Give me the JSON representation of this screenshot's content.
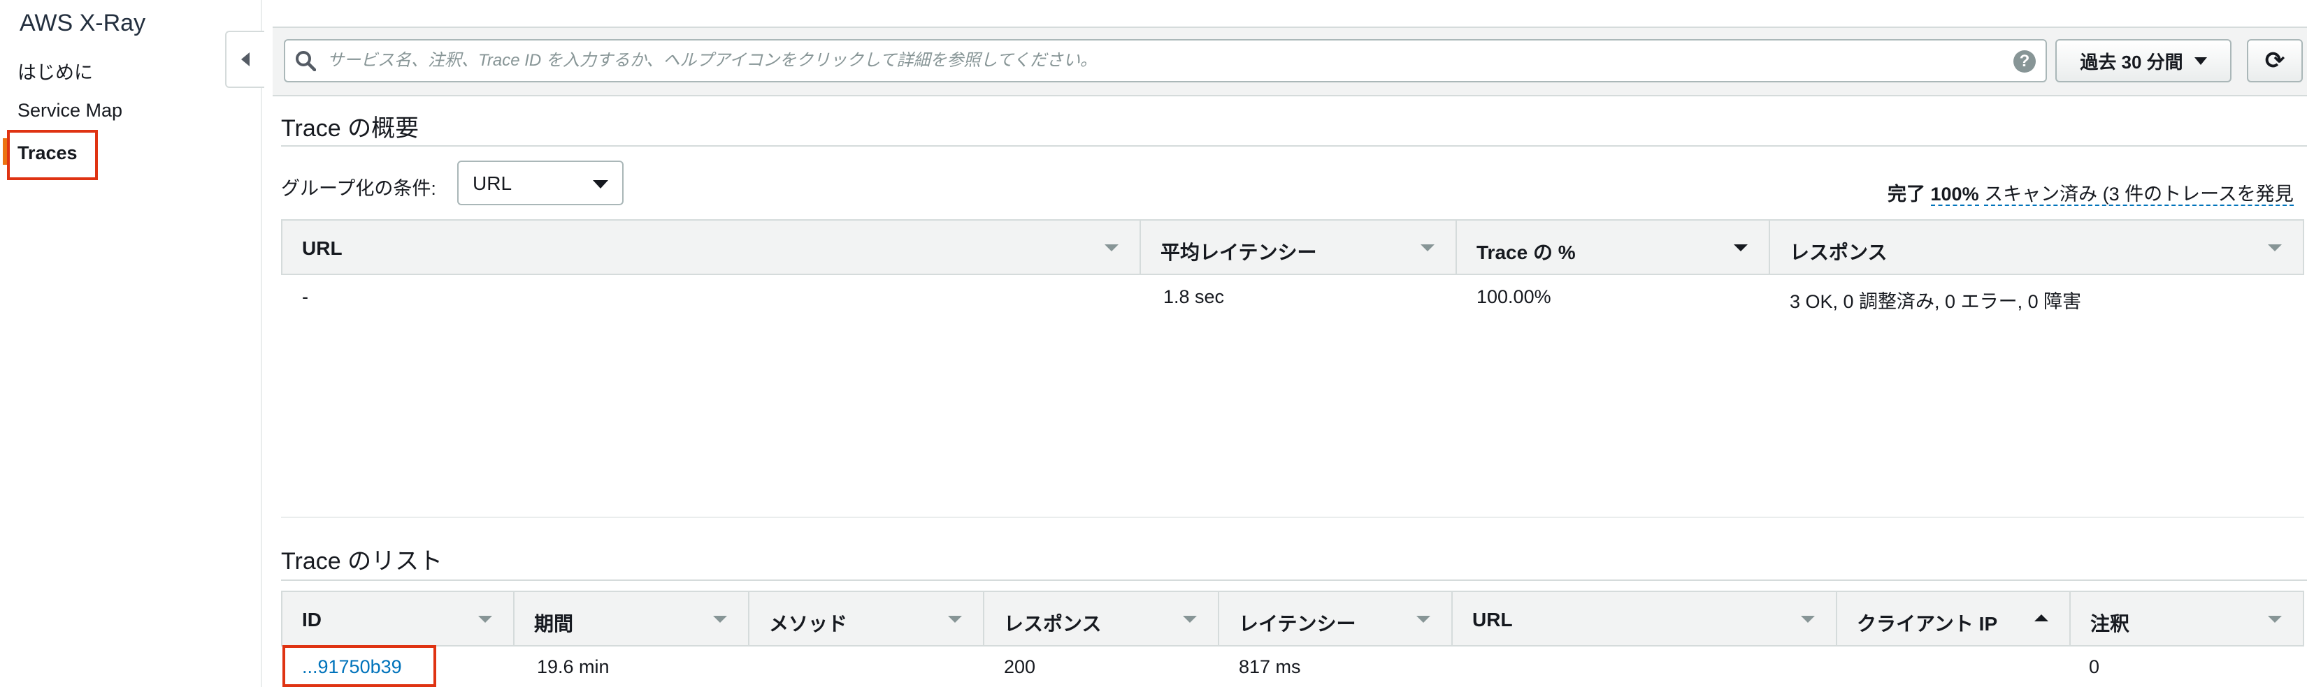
{
  "sidebar": {
    "title": "AWS X-Ray",
    "items": [
      {
        "label": "はじめに"
      },
      {
        "label": "Service Map"
      },
      {
        "label": "Traces"
      }
    ]
  },
  "search": {
    "placeholder": "サービス名、注釈、Trace ID を入力するか、ヘルプアイコンをクリックして詳細を参照してください。",
    "help_symbol": "?"
  },
  "time_range": {
    "label": "過去 30 分間"
  },
  "refresh": {
    "symbol": "⟳"
  },
  "overview": {
    "title": "Trace の概要",
    "group_by_label": "グループ化の条件:",
    "group_by_value": "URL",
    "scan_prefix": "完了",
    "scan_percent": "100%",
    "scan_suffix": "スキャン済み (3 件のトレースを発見",
    "columns": [
      "URL",
      "平均レイテンシー",
      "Trace の %",
      "レスポンス"
    ],
    "rows": [
      {
        "url": "-",
        "avg_latency": "1.8 sec",
        "trace_pct": "100.00%",
        "response": "3 OK, 0 調整済み, 0 エラー, 0 障害"
      }
    ]
  },
  "trace_list": {
    "title": "Trace のリスト",
    "columns": [
      "ID",
      "期間",
      "メソッド",
      "レスポンス",
      "レイテンシー",
      "URL",
      "クライアント IP",
      "注釈"
    ],
    "rows": [
      {
        "id": "...91750b39",
        "age": "19.6 min",
        "method": "",
        "response": "200",
        "latency": "817 ms",
        "url": "",
        "client_ip": "",
        "annotations": "0"
      }
    ]
  },
  "colors": {
    "accent": "#ec7211",
    "link": "#0073bb",
    "highlight": "#df3312"
  }
}
